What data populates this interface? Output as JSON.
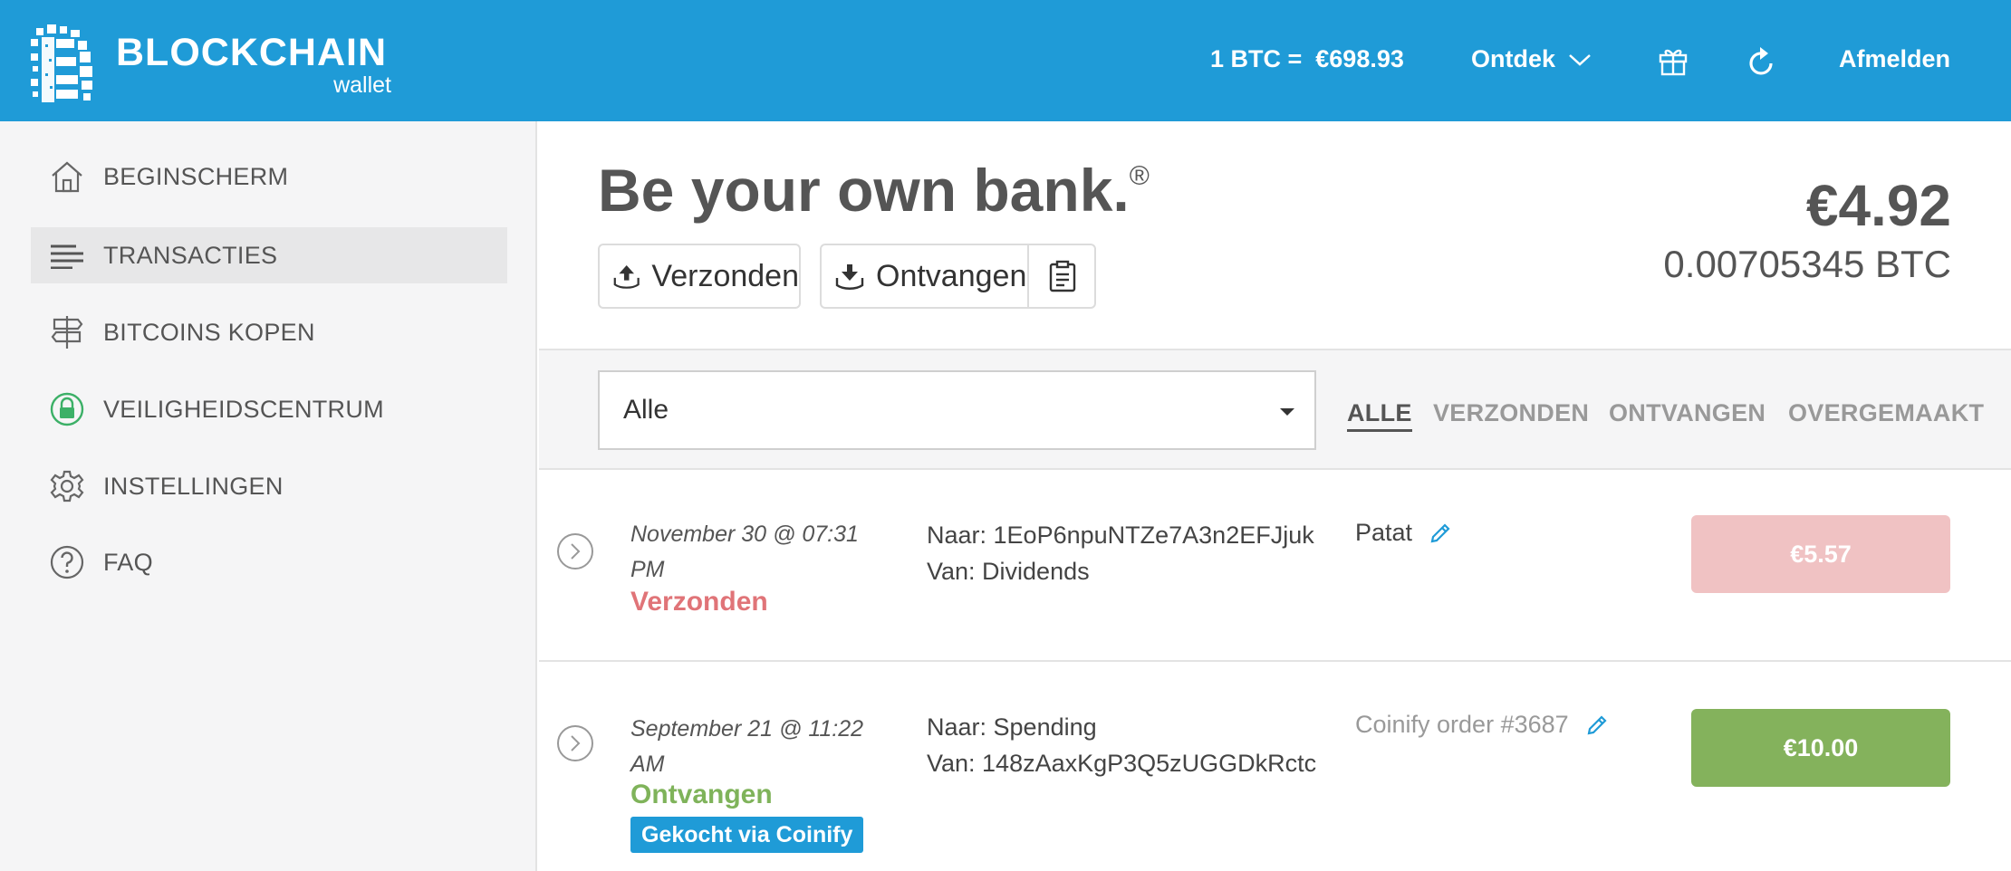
{
  "header": {
    "logo_title": "BLOCKCHAIN",
    "logo_subtitle": "wallet",
    "rate": "1 BTC =  €698.93",
    "discover": "Ontdek",
    "logout": "Afmelden"
  },
  "sidebar": {
    "items": [
      {
        "label": "BEGINSCHERM",
        "icon": "home-icon"
      },
      {
        "label": "TRANSACTIES",
        "icon": "list-icon"
      },
      {
        "label": "BITCOINS KOPEN",
        "icon": "signpost-icon"
      },
      {
        "label": "VEILIGHEIDSCENTRUM",
        "icon": "lock-icon"
      },
      {
        "label": "INSTELLINGEN",
        "icon": "gear-icon"
      },
      {
        "label": "FAQ",
        "icon": "question-icon"
      }
    ],
    "active_index": 1
  },
  "main": {
    "tagline": "Be your own bank.",
    "tagline_mark": "®",
    "send_label": "Verzonden",
    "receive_label": "Ontvangen",
    "balance_fiat": "€4.92",
    "balance_btc": "0.00705345 BTC"
  },
  "filter": {
    "selected": "Alle",
    "tabs": [
      "ALLE",
      "VERZONDEN",
      "ONTVANGEN",
      "OVERGEMAAKT"
    ],
    "active_tab": 0
  },
  "transactions": [
    {
      "date": "November 30 @ 07:31 PM",
      "status": "Verzonden",
      "to": "Naar: 1EoP6npuNTZe7A3n2EFJjuk",
      "from": "Van: Dividends",
      "note": "Patat",
      "amount": "€5.57"
    },
    {
      "date": "September 21 @ 11:22 AM",
      "status": "Ontvangen",
      "badge": "Gekocht via Coinify",
      "to": "Naar: Spending",
      "from": "Van: 148zAaxKgP3Q5zUGGDkRctc",
      "note": "Coinify order #3687",
      "amount": "€10.00"
    }
  ],
  "colors": {
    "brand": "#1f9bd7",
    "sent": "#e07478",
    "sent_amount_bg": "#f0c2c3",
    "received": "#7fb35a",
    "received_amount_bg": "#84b25c"
  }
}
